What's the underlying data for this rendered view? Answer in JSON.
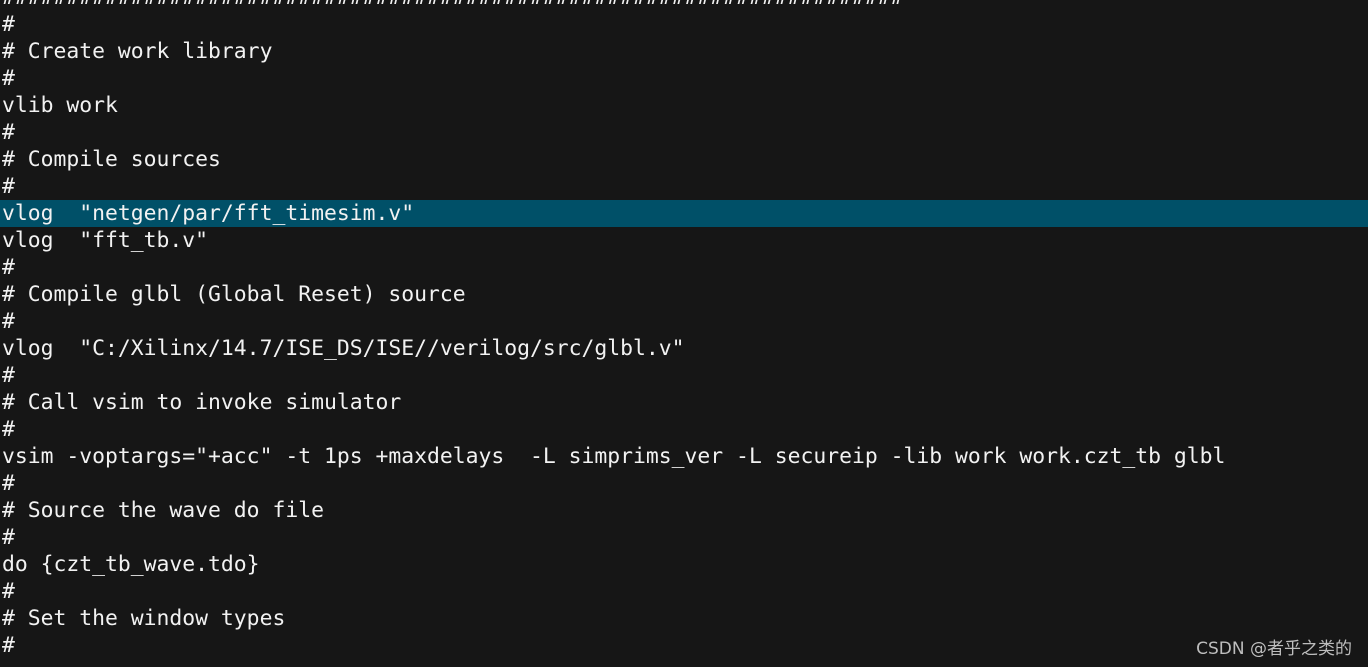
{
  "editor": {
    "highlighted_line": 8,
    "highlight_color": "#005068",
    "background_color": "#161616",
    "lines": [
      "######################################################################",
      "#",
      "# Create work library",
      "#",
      "vlib work",
      "#",
      "# Compile sources",
      "#",
      "vlog  \"netgen/par/fft_timesim.v\"",
      "vlog  \"fft_tb.v\"",
      "#",
      "# Compile glbl (Global Reset) source",
      "#",
      "vlog  \"C:/Xilinx/14.7/ISE_DS/ISE//verilog/src/glbl.v\"",
      "#",
      "# Call vsim to invoke simulator",
      "#",
      "vsim -voptargs=\"+acc\" -t 1ps +maxdelays  -L simprims_ver -L secureip -lib work work.czt_tb glbl",
      "#",
      "# Source the wave do file",
      "#",
      "do {czt_tb_wave.tdo}",
      "#",
      "# Set the window types",
      "#"
    ]
  },
  "watermark": "CSDN @者乎之类的"
}
